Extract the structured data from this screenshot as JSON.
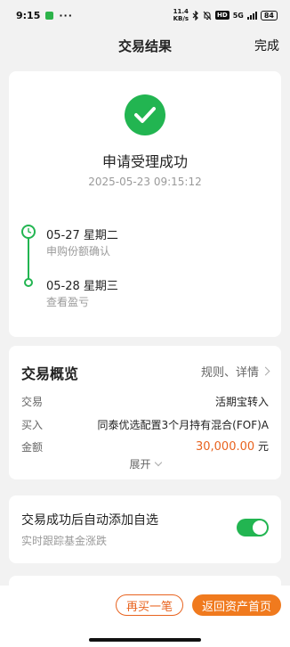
{
  "status": {
    "time": "9:15",
    "more": "···",
    "speed_top": "11.4",
    "speed_unit": "KB/s",
    "hd": "HD",
    "net_label": "5G",
    "battery": "84"
  },
  "nav": {
    "title": "交易结果",
    "done": "完成"
  },
  "result": {
    "title": "申请受理成功",
    "time": "2025-05-23 09:15:12",
    "steps": [
      {
        "date": "05-27  星期二",
        "desc": "申购份额确认"
      },
      {
        "date": "05-28  星期三",
        "desc": "查看盈亏"
      }
    ]
  },
  "overview": {
    "title": "交易概览",
    "rules_label": "规则、详情",
    "rows": [
      {
        "label": "交易",
        "value": "活期宝转入"
      },
      {
        "label": "买入",
        "value": "同泰优选配置3个月持有混合(FOF)A"
      },
      {
        "label": "金额",
        "value": "30,000.00",
        "unit": "元"
      }
    ],
    "expand_label": "展开"
  },
  "follow": {
    "title": "交易成功后自动添加自选",
    "subtitle": "实时跟踪基金涨跌",
    "enabled": true
  },
  "footer": {
    "buy_again": "再买一笔",
    "back_home": "返回资产首页"
  },
  "colors": {
    "success": "#22b551",
    "accent": "#e8631f",
    "primary_button": "#f07a1e"
  }
}
